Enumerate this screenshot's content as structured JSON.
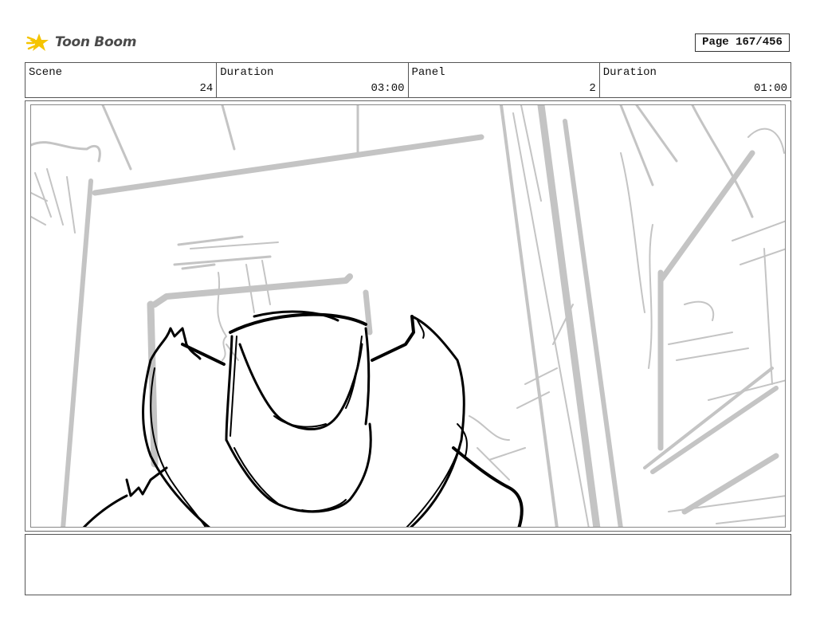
{
  "brand": {
    "logo_text": "Toon Boom",
    "accent_color": "#f5c400",
    "icon": "toon-boom-star-icon"
  },
  "page": {
    "label": "Page 167/456"
  },
  "header": {
    "scene_label": "Scene",
    "scene_value": "24",
    "scene_duration_label": "Duration",
    "scene_duration_value": "03:00",
    "panel_label": "Panel",
    "panel_value": "2",
    "panel_duration_label": "Duration",
    "panel_duration_value": "01:00"
  },
  "panel_image": {
    "icon": "storyboard-sketch-image",
    "sketch_color": "#000000",
    "background_sketch_color": "#c4c4c4"
  },
  "notes": {
    "text": ""
  }
}
